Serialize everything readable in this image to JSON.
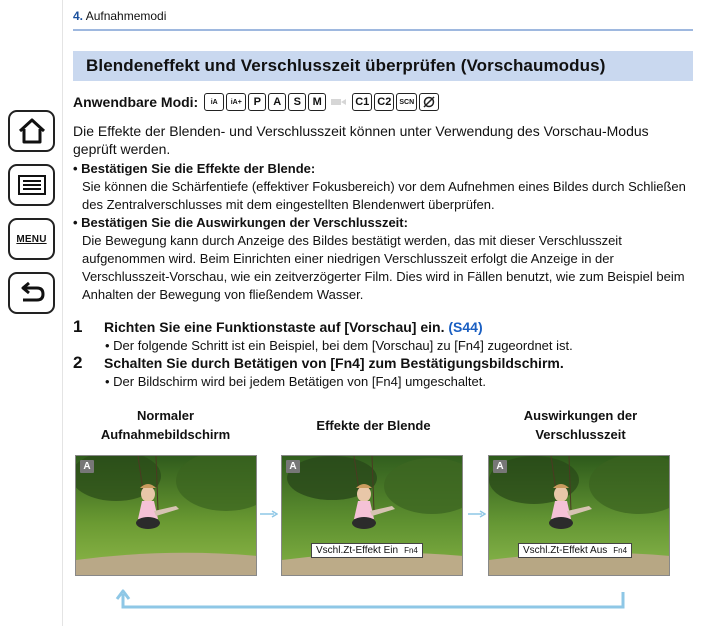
{
  "chapter": {
    "number": "4.",
    "title": "Aufnahmemodi"
  },
  "section_title": "Blendeneffekt und Verschlusszeit überprüfen (Vorschaumodus)",
  "modes_label": "Anwendbare Modi:",
  "modes": [
    "iA",
    "iA+",
    "P",
    "A",
    "S",
    "M",
    "Film",
    "C1",
    "C2",
    "SCN",
    "Kreativ"
  ],
  "intro": "Die Effekte der Blenden- und Verschlusszeit können unter Verwendung des Vorschau-Modus geprüft werden.",
  "bullets": [
    {
      "heading": "• Bestätigen Sie die Effekte der Blende:",
      "text": "Sie können die Schärfentiefe (effektiver Fokusbereich) vor dem Aufnehmen eines Bildes durch Schließen des Zentralverschlusses mit dem eingestellten Blendenwert überprüfen."
    },
    {
      "heading": "• Bestätigen Sie die Auswirkungen der Verschlusszeit:",
      "text": "Die Bewegung kann durch Anzeige des Bildes bestätigt werden, das mit dieser Verschlusszeit aufgenommen wird. Beim Einrichten einer niedrigen Verschlusszeit erfolgt die Anzeige in der Verschlusszeit-Vorschau, wie ein zeitverzögerter Film. Dies wird in Fällen benutzt, wie zum Beispiel beim Anhalten der Bewegung von fließendem Wasser."
    }
  ],
  "steps": [
    {
      "num": "1",
      "title": "Richten Sie eine Funktionstaste auf [Vorschau] ein.",
      "ref": "(S44)",
      "note": "• Der folgende Schritt ist ein Beispiel, bei dem [Vorschau] zu [Fn4] zugeordnet ist."
    },
    {
      "num": "2",
      "title": "Schalten Sie durch Betätigen von [Fn4] zum Bestätigungsbildschirm.",
      "ref": "",
      "note": "• Der Bildschirm wird bei jedem Betätigen von [Fn4] umgeschaltet."
    }
  ],
  "screens": [
    {
      "caption_line1": "Normaler",
      "caption_line2": "Aufnahmebildschirm",
      "mode_chip": "A",
      "overlay": "",
      "overlay_fn": ""
    },
    {
      "caption_line1": "Effekte der Blende",
      "caption_line2": "",
      "mode_chip": "A",
      "overlay": "Vschl.Zt-Effekt Ein",
      "overlay_fn": "Fn4"
    },
    {
      "caption_line1": "Auswirkungen der",
      "caption_line2": "Verschlusszeit",
      "mode_chip": "A",
      "overlay": "Vschl.Zt-Effekt Aus",
      "overlay_fn": "Fn4"
    }
  ],
  "nav": {
    "home_icon": "home-icon",
    "toc_icon": "table-of-contents-icon",
    "menu_label": "MENU",
    "back_icon": "back-icon"
  },
  "colors": {
    "section_bar": "#c9d8ef",
    "chapter_rule": "#9eb8df",
    "link": "#1a5fc2",
    "flow_arrow": "#8ec7e6"
  }
}
